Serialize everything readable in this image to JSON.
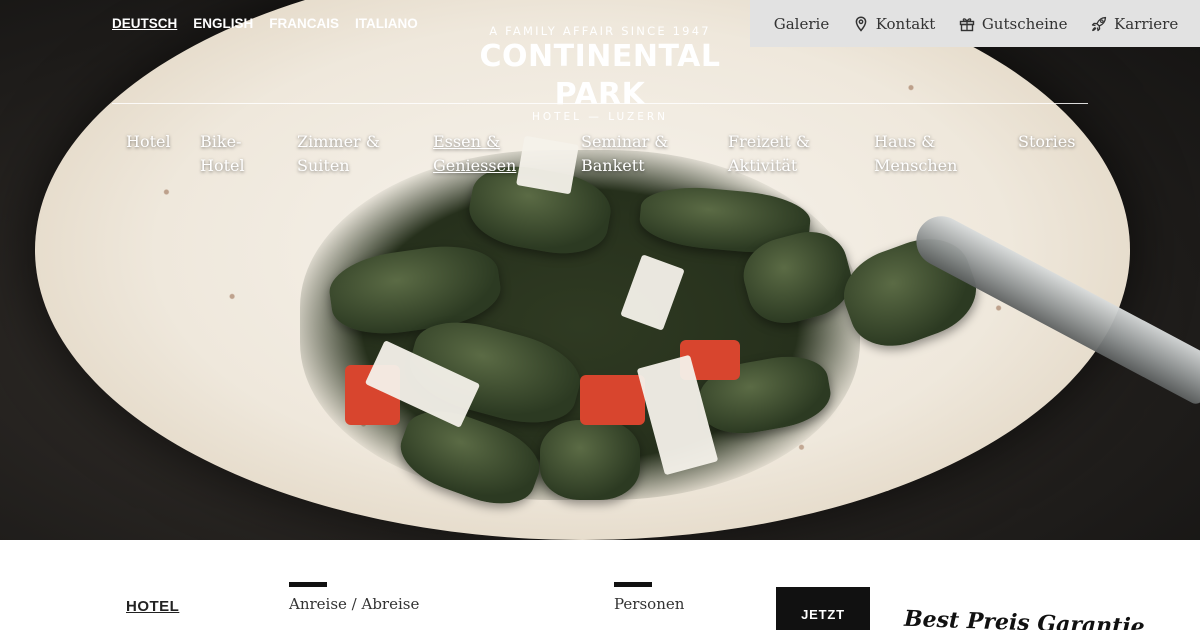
{
  "languages": [
    {
      "label": "DEUTSCH",
      "active": true
    },
    {
      "label": "ENGLISH",
      "active": false
    },
    {
      "label": "FRANCAIS",
      "active": false
    },
    {
      "label": "ITALIANO",
      "active": false
    }
  ],
  "brand": {
    "tagline": "A FAMILY AFFAIR SINCE 1947",
    "name": "CONTINENTAL PARK",
    "subline": "HOTEL — LUZERN"
  },
  "utility": [
    {
      "label": "Galerie",
      "icon": null
    },
    {
      "label": "Kontakt",
      "icon": "location-pin-icon"
    },
    {
      "label": "Gutscheine",
      "icon": "gift-icon"
    },
    {
      "label": "Karriere",
      "icon": "rocket-icon"
    }
  ],
  "nav": [
    {
      "line1": "Hotel",
      "line2": ""
    },
    {
      "line1": "Bike-",
      "line2": "Hotel"
    },
    {
      "line1": "Zimmer &",
      "line2": "Suiten"
    },
    {
      "line1": "Essen &",
      "line2": "Geniessen",
      "active": true
    },
    {
      "line1": "Seminar &",
      "line2": "Bankett"
    },
    {
      "line1": "Freizeit &",
      "line2": "Aktivität"
    },
    {
      "line1": "Haus &",
      "line2": "Menschen"
    },
    {
      "line1": "Stories",
      "line2": ""
    }
  ],
  "booking": {
    "hotel_label": "HOTEL",
    "dates_label": "Anreise / Abreise",
    "persons_label": "Personen",
    "submit_label": "JETZT",
    "guarantee": "Best Preis Garantie"
  },
  "colors": {
    "utility_bg": "#e2e2e2",
    "button_bg": "#111111",
    "text_light": "#ffffff"
  }
}
